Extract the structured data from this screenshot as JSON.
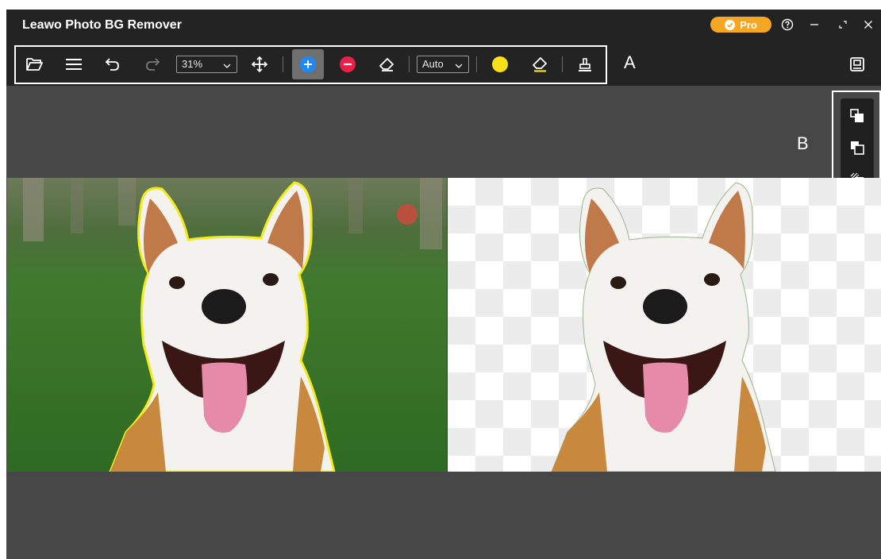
{
  "app": {
    "title": "Leawo Photo BG Remover"
  },
  "pro": {
    "label": "Pro",
    "color": "#f5a623"
  },
  "toolbar": {
    "zoom_value": "31%",
    "mode_value": "Auto",
    "icons": [
      "folder-open-icon",
      "menu-icon",
      "undo-icon",
      "redo-icon",
      "move-icon",
      "add-brush-icon",
      "remove-brush-icon",
      "eraser-icon",
      "color-dot-icon",
      "eraser-icon",
      "stamp-icon"
    ],
    "brush_color": "#f7e017",
    "add_color": "#1e88ff",
    "remove_color": "#e8204a"
  },
  "annotations": {
    "a": "A",
    "b": "B"
  },
  "view_buttons": [
    "view-front-icon",
    "view-back-icon",
    "view-transparent-icon"
  ]
}
